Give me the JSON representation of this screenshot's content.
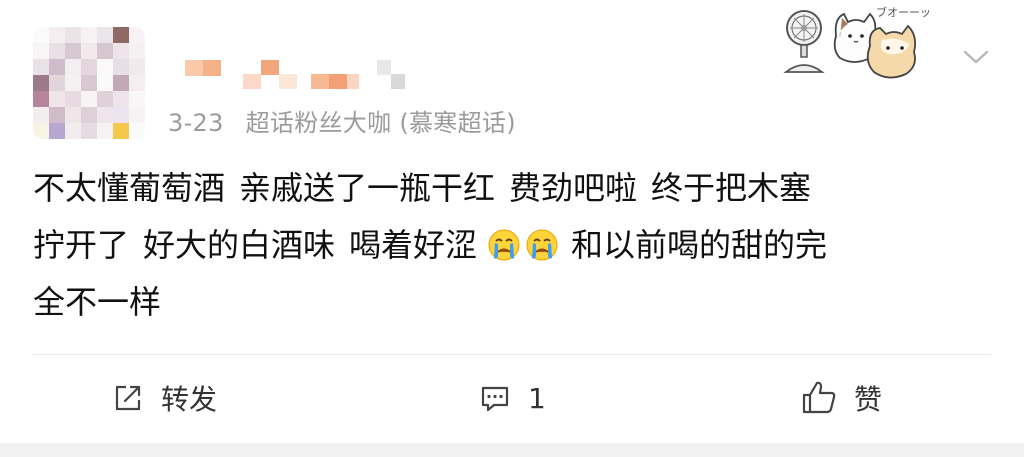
{
  "post": {
    "date": "3-23",
    "source": "超话粉丝大咖 (慕寒超话)",
    "content_lines": [
      [
        "不太懂葡萄酒",
        "亲戚送了一瓶干红",
        "费劲吧啦",
        "终于把木塞"
      ],
      [
        "拧开了",
        "好大的白酒味",
        "喝着好涩",
        "和以前喝的甜的完"
      ],
      [
        "全不一样"
      ]
    ],
    "emojis": [
      "crying-face",
      "crying-face"
    ]
  },
  "sticker": {
    "text": "ブオーーッ"
  },
  "actions": {
    "share_label": "转发",
    "comment_count": "1",
    "like_label": "赞"
  },
  "colors": {
    "text": "#111111",
    "meta": "#9b9b9b",
    "divider": "#e9e9e9"
  }
}
